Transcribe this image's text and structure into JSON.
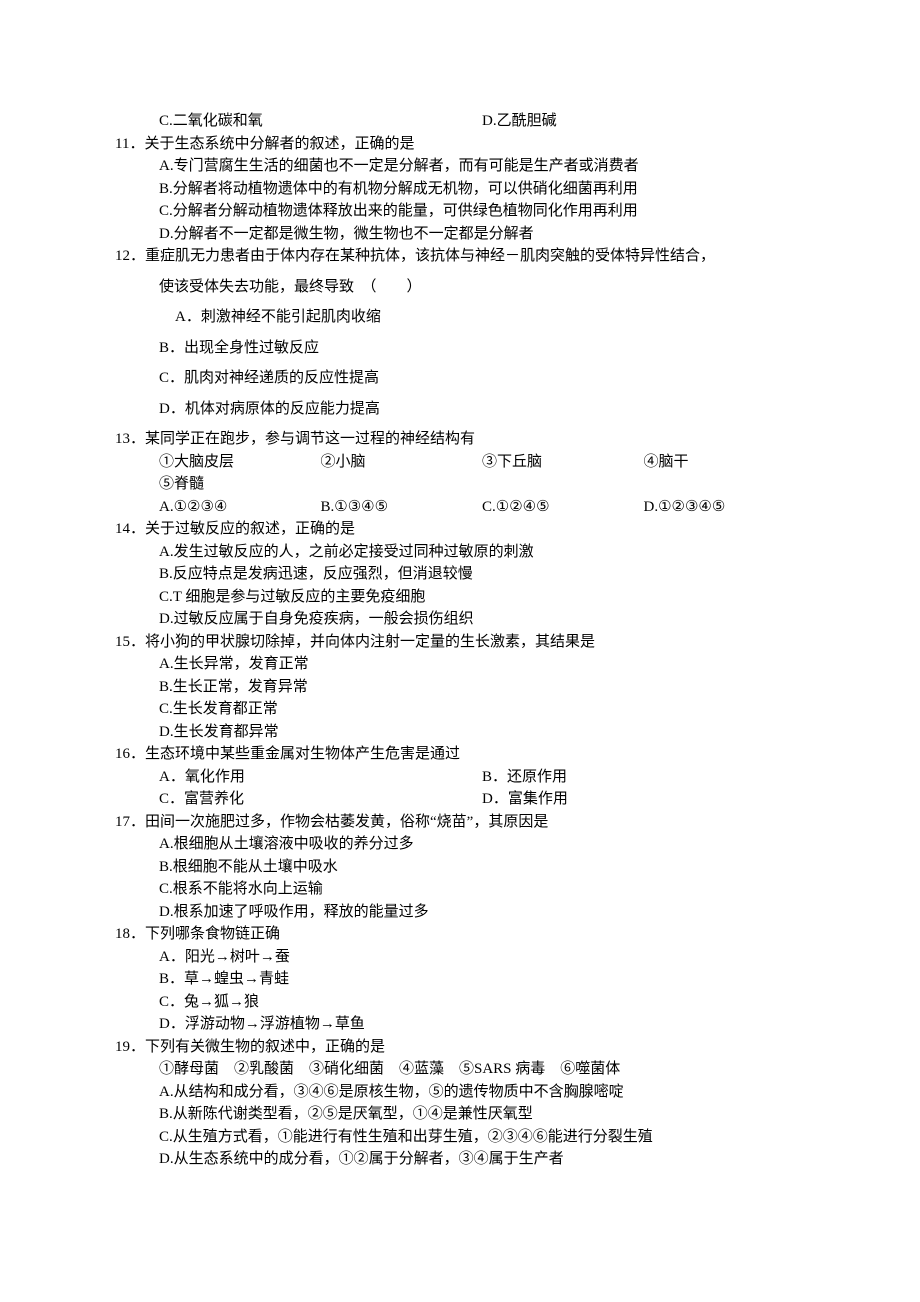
{
  "q10": {
    "optC": "C.二氧化碳和氧",
    "optD": "D.乙酰胆碱"
  },
  "q11": {
    "stem": "11．关于生态系统中分解者的叙述，正确的是",
    "optA": "A.专门营腐生生活的细菌也不一定是分解者，而有可能是生产者或消费者",
    "optB": "B.分解者将动植物遗体中的有机物分解成无机物，可以供硝化细菌再利用",
    "optC": "C.分解者分解动植物遗体释放出来的能量，可供绿色植物同化作用再利用",
    "optD": "D.分解者不一定都是微生物，微生物也不一定都是分解者"
  },
  "q12": {
    "stem": "12．重症肌无力患者由于体内存在某种抗体，该抗体与神经－肌肉突触的受体特异性结合，",
    "stem2": "使该受体失去功能，最终导致　（　　）",
    "optA": "A．刺激神经不能引起肌肉收缩",
    "optB": "B．出现全身性过敏反应",
    "optC": "C．肌肉对神经递质的反应性提高",
    "optD": "D．机体对病原体的反应能力提高"
  },
  "q13": {
    "stem": "13．某同学正在跑步，参与调节这一过程的神经结构有",
    "items": {
      "a": "①大脑皮层",
      "b": "②小脑",
      "c": "③下丘脑",
      "d": "④脑干",
      "e": "⑤脊髓"
    },
    "optA": "A.①②③④",
    "optB": "B.①③④⑤",
    "optC": "C.①②④⑤",
    "optD": "D.①②③④⑤"
  },
  "q14": {
    "stem": "14．关于过敏反应的叙述，正确的是",
    "optA": "A.发生过敏反应的人，之前必定接受过同种过敏原的刺激",
    "optB": "B.反应特点是发病迅速，反应强烈，但消退较慢",
    "optC": "C.T 细胞是参与过敏反应的主要免疫细胞",
    "optD": "D.过敏反应属于自身免疫疾病，一般会损伤组织"
  },
  "q15": {
    "stem": "15．将小狗的甲状腺切除掉，并向体内注射一定量的生长激素，其结果是",
    "optA": "A.生长异常，发育正常",
    "optB": "B.生长正常，发育异常",
    "optC": "C.生长发育都正常",
    "optD": "D.生长发育都异常"
  },
  "q16": {
    "stem": "16．生态环境中某些重金属对生物体产生危害是通过",
    "optA": "A．氧化作用",
    "optB": "B．还原作用",
    "optC": "C．富营养化",
    "optD": "D．富集作用"
  },
  "q17": {
    "stem": "17．田间一次施肥过多，作物会枯萎发黄，俗称“烧苗”，其原因是",
    "optA": "A.根细胞从土壤溶液中吸收的养分过多",
    "optB": "B.根细胞不能从土壤中吸水",
    "optC": "C.根系不能将水向上运输",
    "optD": "D.根系加速了呼吸作用，释放的能量过多"
  },
  "q18": {
    "stem": "18．下列哪条食物链正确",
    "optA": "A．阳光→树叶→蚕",
    "optB": "B．草→蝗虫→青蛙",
    "optC": "C．兔→狐→狼",
    "optD": "D．浮游动物→浮游植物→草鱼"
  },
  "q19": {
    "stem": "19．下列有关微生物的叙述中，正确的是",
    "items": "①酵母菌　②乳酸菌　③硝化细菌　④蓝藻　⑤SARS 病毒　⑥噬菌体",
    "optA": "A.从结构和成分看，③④⑥是原核生物，⑤的遗传物质中不含胸腺嘧啶",
    "optB": "B.从新陈代谢类型看，②⑤是厌氧型，①④是兼性厌氧型",
    "optC": "C.从生殖方式看，①能进行有性生殖和出芽生殖，②③④⑥能进行分裂生殖",
    "optD": "D.从生态系统中的成分看，①②属于分解者，③④属于生产者"
  }
}
